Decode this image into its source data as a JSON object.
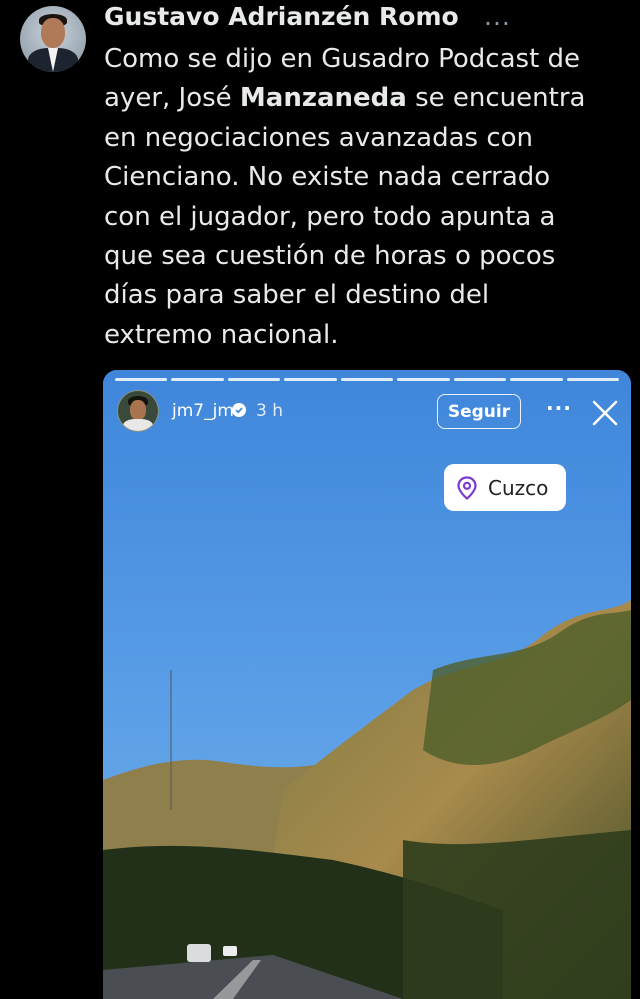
{
  "tweet": {
    "author_name": "Gustavo Adrianzén Romo",
    "more_label": "...",
    "text_line_1": "Como se dijo en Gusadro Podcast de",
    "text_line_2_pre": "ayer, José ",
    "text_line_2_bold": "Manzaneda",
    "text_line_2_post": " se encuentra",
    "text_line_3": "en negociaciones avanzadas con",
    "text_line_4": "Cienciano. No existe nada cerrado",
    "text_line_5": "con el jugador, pero todo apunta a",
    "text_line_6": "que sea cuestión de horas o pocos",
    "text_line_7": "días para saber el destino del",
    "text_line_8": "extremo nacional."
  },
  "story": {
    "progress_segments": 9,
    "username": "jm7_jm",
    "time": "3 h",
    "follow_label": "Seguir",
    "more_label": "···",
    "location": "Cuzco"
  },
  "colors": {
    "background": "#000000",
    "text": "#e7e9ea",
    "sky": "#4a8fde",
    "location_pin": "#7a3ad1"
  },
  "icons": [
    "avatar",
    "verified-icon",
    "close-icon",
    "location-pin-icon"
  ]
}
